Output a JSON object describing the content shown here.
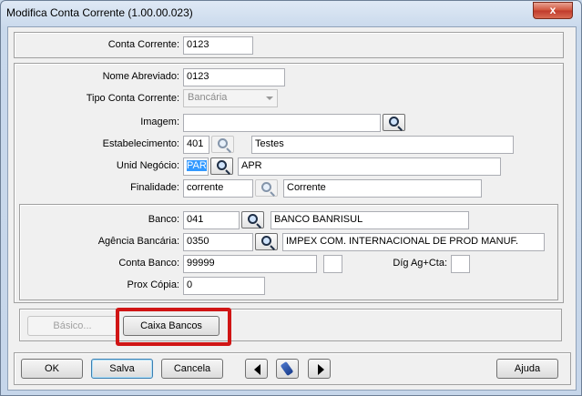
{
  "window": {
    "title": "Modifica Conta Corrente (1.00.00.023)",
    "close_label": "x"
  },
  "account": {
    "label": "Conta Corrente:",
    "value": "0123"
  },
  "general": {
    "nome_abreviado": {
      "label": "Nome Abreviado:",
      "value": "0123"
    },
    "tipo_conta": {
      "label": "Tipo Conta Corrente:",
      "value": "Bancária"
    },
    "imagem": {
      "label": "Imagem:",
      "value": ""
    },
    "estabelecimento": {
      "label": "Estabelecimento:",
      "code": "401",
      "desc": "Testes"
    },
    "unid_negocio": {
      "label": "Unid Negócio:",
      "code": "PAR",
      "desc": "APR"
    },
    "finalidade": {
      "label": "Finalidade:",
      "code": "corrente",
      "desc": "Corrente"
    }
  },
  "bank": {
    "banco": {
      "label": "Banco:",
      "code": "041",
      "desc": "BANCO BANRISUL"
    },
    "agencia": {
      "label": "Agência Bancária:",
      "code": "0350",
      "desc": "IMPEX COM. INTERNACIONAL DE PROD MANUF."
    },
    "conta_banco": {
      "label": "Conta Banco:",
      "value": "99999",
      "digit": ""
    },
    "dig_ag_cta": {
      "label": "Díg Ag+Cta:",
      "value": ""
    },
    "prox_copia": {
      "label": "Prox Cópia:",
      "value": "0"
    }
  },
  "tabs": {
    "basico": "Básico...",
    "caixa_bancos": "Caixa Bancos"
  },
  "footer": {
    "ok": "OK",
    "salva": "Salva",
    "cancela": "Cancela",
    "ajuda": "Ajuda"
  }
}
